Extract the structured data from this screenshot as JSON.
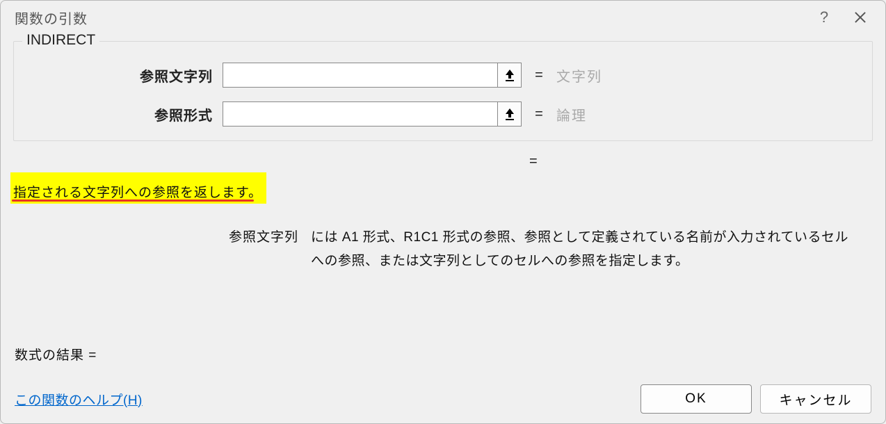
{
  "dialog": {
    "title": "関数の引数",
    "help_glyph": "?"
  },
  "function": {
    "name": "INDIRECT",
    "args": [
      {
        "label": "参照文字列",
        "value": "",
        "hint": "文字列"
      },
      {
        "label": "参照形式",
        "value": "",
        "hint": "論理"
      }
    ],
    "result_prefix": "="
  },
  "description": {
    "highlighted": "指定される文字列への参照を返します。",
    "arg_name": "参照文字列",
    "arg_text": "には A1 形式、R1C1 形式の参照、参照として定義されている名前が入力されているセルへの参照、または文字列としてのセルへの参照を指定します。"
  },
  "footer": {
    "formula_result_label": "数式の結果 =",
    "help_link": "この関数のヘルプ(H)",
    "ok": "OK",
    "cancel": "キャンセル"
  }
}
